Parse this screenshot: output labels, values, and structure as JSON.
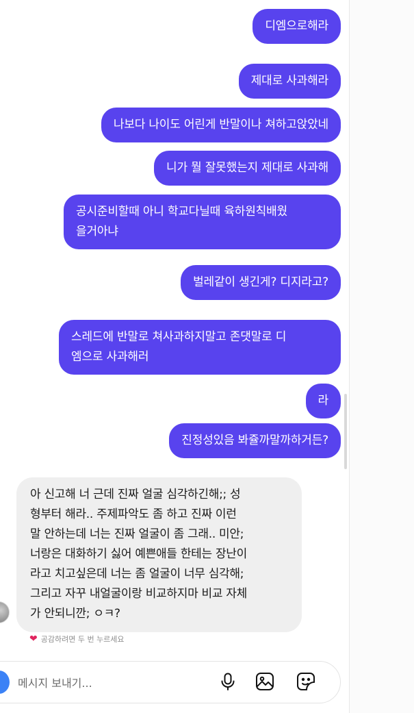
{
  "conversation": {
    "messages_out": [
      {
        "text": "디엠으로해라"
      },
      {
        "text": "제대로 사과해라"
      },
      {
        "text": "나보다 나이도 어린게 반말이나 쳐하고앉았네"
      },
      {
        "text": "니가 뭘 잘못했는지 제대로 사과해"
      },
      {
        "text": "공시준비할때 아니 학교다닐때 육하원칙배웠\n을거아냐"
      },
      {
        "text": "벌레같이 생긴게? 디지라고?"
      },
      {
        "text": "스레드에 반말로 쳐사과하지말고 존댓말로 디\n엠으로 사과해러"
      },
      {
        "text": "라"
      },
      {
        "text": "진정성있음 봐쥴까말까하거든?"
      }
    ],
    "message_in": {
      "text": "아 신고해 너 근데 진짜 얼굴 심각하긴해;; 성\n형부터 해라.. 주제파악도 좀 하고 진짜 이런\n말 안하는데 너는 진짜 얼굴이 좀 그래.. 미안;\n너랑은 대화하기 싫어 예쁜애들 한테는 장난이\n라고 치고싶은데 너는 좀 얼굴이 너무 심각해;\n그리고 자꾸 내얼굴이랑 비교하지마 비교 자체\n가 안되니깐; ㅇㅋ?"
    },
    "reaction_hint": "공감하려면 두 번 누르세요"
  },
  "composer": {
    "placeholder": "메시지 보내기...",
    "icons": [
      "camera-icon",
      "microphone-icon",
      "image-icon",
      "sticker-icon"
    ]
  },
  "colors": {
    "outgoing_bubble": "#5843ee",
    "incoming_bubble": "#efefef",
    "heart": "#e0245e",
    "camera_button": "#3b82f6"
  }
}
